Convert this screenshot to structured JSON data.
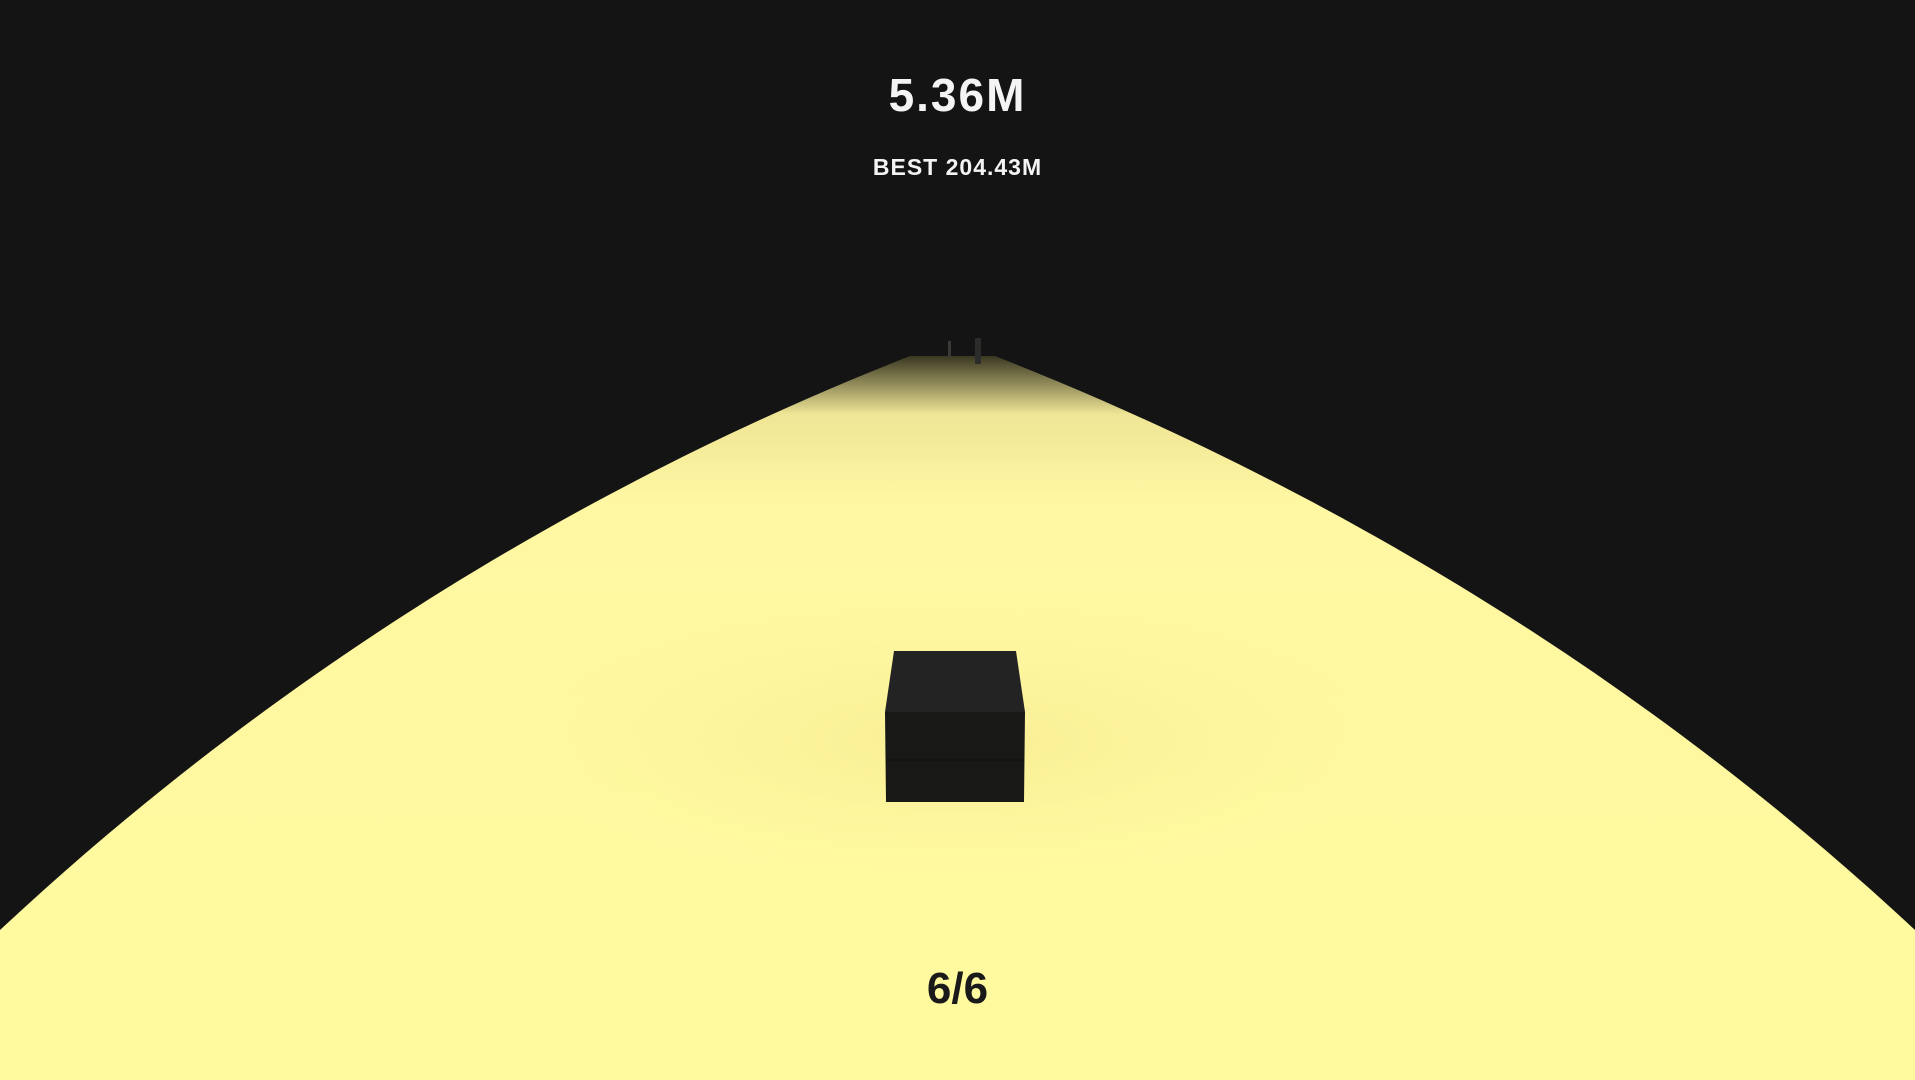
{
  "hud": {
    "distance": "5.36M",
    "best": "BEST 204.43M",
    "lives": "6/6"
  },
  "colors": {
    "background": "#141414",
    "road": "#fffa9e",
    "player_cube": "#1b1b1a",
    "text_light": "#f4f4f4",
    "text_dark": "#1a1a1a"
  }
}
